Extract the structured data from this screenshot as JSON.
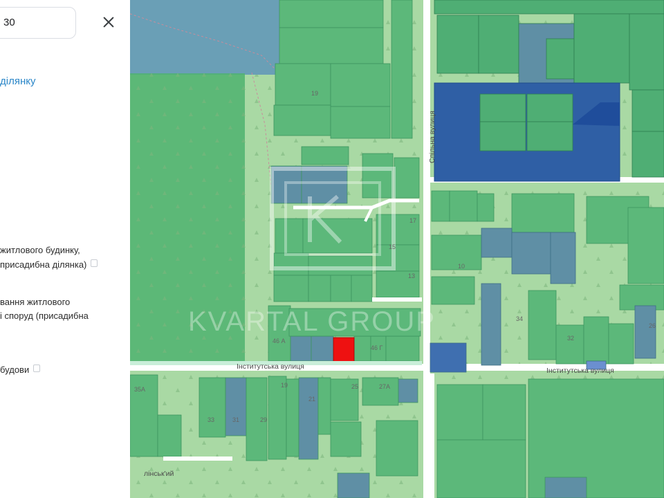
{
  "search": {
    "value": "30"
  },
  "panel": {
    "plot_link": "ділянку",
    "purpose_1_line1": "житлового будинку,",
    "purpose_1_line2": "присадибна ділянка)",
    "purpose_2_line1": "вання житлового",
    "purpose_2_line2": "і споруд (присадибна",
    "purpose_3": "будови"
  },
  "map": {
    "street_bottom_left": "Інститутська вулиця",
    "street_bottom_right": "Інститутська вулиця",
    "street_vertical": "Спільна вулиця",
    "street_bottom_left_small": "лінськ'ий",
    "watermark": "KVARTAL GROUP",
    "house_numbers": [
      "19",
      "17",
      "15",
      "13",
      "46 А",
      "46 Г",
      "10",
      "34",
      "32",
      "26",
      "35А",
      "33",
      "31",
      "29",
      "27А",
      "25",
      "21",
      "19"
    ]
  }
}
